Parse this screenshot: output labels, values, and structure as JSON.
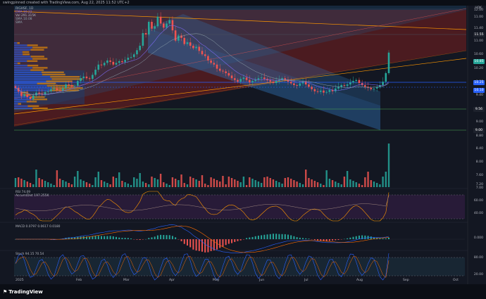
{
  "header": {
    "caption": "swingpinned created with TradingView.com, Aug 22, 2025 11:52 UTC+2"
  },
  "main_legend": {
    "symbol": "RIGHSF, 1D",
    "ohlc": "10.85",
    "ema": "EMA 10.22",
    "vol": "Vol 291.315K",
    "sma": "SMA 10.08",
    "sma2": "SMA"
  },
  "rsi_legend": {
    "line1": "RSI 74.09",
    "line2": "Accum/Dist 197.255K"
  },
  "macd_legend": {
    "text": "MACD 0.0797 0.0617 0.0180"
  },
  "stoch_legend": {
    "text": "Stoch 94.15 70.54"
  },
  "currency": "HOK",
  "price_axis": [
    "12.00",
    "11.00",
    "11.40",
    "11.00",
    "10.60",
    "10.20",
    "9.80",
    "9.40",
    "9.00",
    "8.80",
    "8.40",
    "8.00",
    "7.60",
    "7.20",
    "7.00"
  ],
  "price_tags": [
    {
      "label": "11.55",
      "color": "#1e222d"
    },
    {
      "label": "10.85",
      "color": "#26a69a"
    },
    {
      "label": "10.25",
      "color": "#2962ff"
    },
    {
      "label": "10.10",
      "color": "#2962ff"
    },
    {
      "label": "9.56",
      "color": "#1e222d"
    },
    {
      "label": "9.00",
      "color": "#1e222d"
    }
  ],
  "rsi_axis": [
    "60.00",
    "40.00"
  ],
  "macd_axis": [
    "0.000"
  ],
  "stoch_axis": [
    "80.00",
    "20.00"
  ],
  "months": [
    "2025",
    "Feb",
    "Mar",
    "Apr",
    "May",
    "Jun",
    "Jul",
    "Aug",
    "Sep",
    "Oct"
  ],
  "logo": "TradingView",
  "colors": {
    "up": "#26a69a",
    "down": "#ef5350",
    "bg": "#131722",
    "channel": "#ff9800",
    "accent": "#2962ff"
  },
  "chart_data": {
    "type": "candlestick",
    "x_range": [
      "2025-01-01",
      "2025-10-20"
    ],
    "ylim": [
      7.0,
      12.1
    ],
    "closes": [
      9.82,
      9.71,
      9.58,
      9.63,
      9.55,
      9.49,
      9.6,
      9.68,
      9.65,
      9.62,
      9.7,
      9.72,
      9.78,
      9.8,
      9.76,
      9.74,
      9.81,
      9.92,
      9.9,
      9.86,
      9.88,
      10.02,
      10.1,
      10.15,
      10.1,
      10.08,
      10.2,
      10.35,
      10.5,
      10.48,
      10.55,
      10.62,
      10.58,
      10.5,
      10.55,
      10.6,
      10.57,
      10.64,
      10.7,
      10.72,
      10.8,
      10.92,
      11.05,
      11.42,
      11.38,
      11.75,
      11.55,
      11.62,
      11.9,
      11.7,
      11.58,
      11.7,
      11.8,
      11.5,
      11.2,
      11.35,
      11.28,
      11.1,
      11.15,
      11.05,
      10.98,
      11.02,
      10.9,
      10.8,
      10.75,
      10.62,
      10.55,
      10.5,
      10.38,
      10.32,
      10.3,
      10.25,
      10.18,
      10.1,
      10.05,
      10.0,
      10.08,
      10.12,
      10.05,
      9.98,
      10.02,
      10.06,
      10.1,
      10.12,
      10.08,
      10.04,
      10.0,
      9.96,
      10.02,
      10.05,
      10.1,
      10.06,
      10.0,
      9.95,
      9.9,
      9.88,
      9.95,
      10.0,
      9.92,
      9.85,
      9.78,
      9.72,
      9.7,
      9.74,
      9.68,
      9.7,
      9.76,
      9.72,
      9.8,
      9.85,
      9.9,
      9.88,
      9.92,
      9.98,
      10.02,
      10.05,
      9.96,
      9.9,
      9.85,
      9.82,
      9.78,
      9.8,
      9.84,
      9.9,
      10.0,
      10.25,
      10.85
    ],
    "volume_spike_last": true,
    "rsi_last": 74.09,
    "macd_last": 0.0797,
    "stoch_last": [
      94.15,
      70.54
    ],
    "levels": [
      12.0,
      11.55,
      10.85,
      10.25,
      10.1,
      9.56,
      9.0
    ]
  }
}
